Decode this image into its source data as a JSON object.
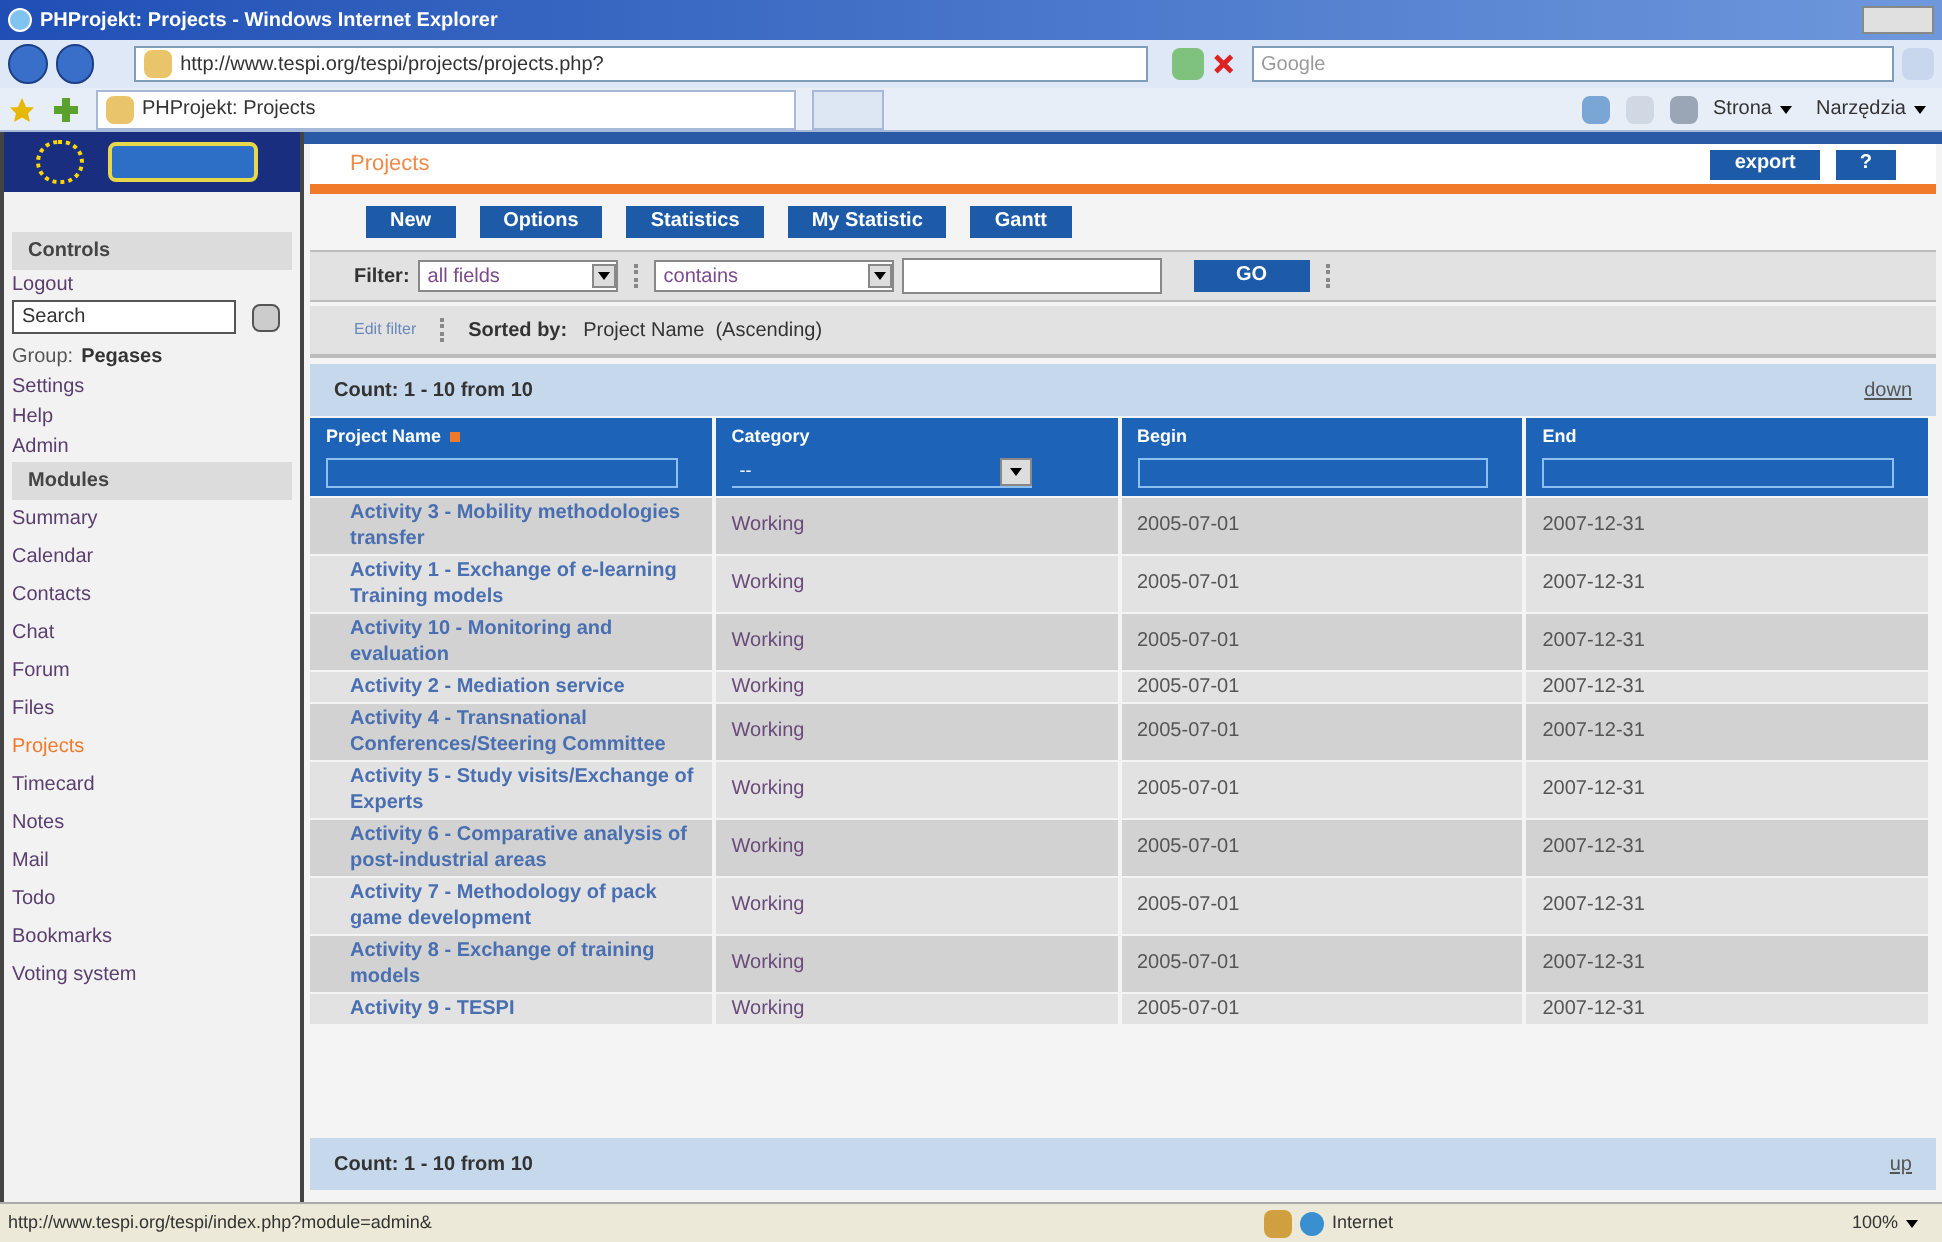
{
  "window": {
    "title": "PHProjekt: Projects - Windows Internet Explorer"
  },
  "browser": {
    "address": "http://www.tespi.org/tespi/projects/projects.php?",
    "search_placeholder": "Google",
    "tab": "PHProjekt: Projects",
    "toolbar": [
      "Strona",
      "Narzędzia"
    ]
  },
  "sidebar": {
    "controls_heading": "Controls",
    "logout": "Logout",
    "search_placeholder": "Search",
    "group_label": "Group:",
    "group_name": "Pegases",
    "links": [
      "Settings",
      "Help",
      "Admin"
    ],
    "modules_heading": "Modules",
    "modules": [
      {
        "label": "Summary",
        "selected": false
      },
      {
        "label": "Calendar",
        "selected": false
      },
      {
        "label": "Contacts",
        "selected": false
      },
      {
        "label": "Chat",
        "selected": false
      },
      {
        "label": "Forum",
        "selected": false
      },
      {
        "label": "Files",
        "selected": false
      },
      {
        "label": "Projects",
        "selected": true
      },
      {
        "label": "Timecard",
        "selected": false
      },
      {
        "label": "Notes",
        "selected": false
      },
      {
        "label": "Mail",
        "selected": false
      },
      {
        "label": "Todo",
        "selected": false
      },
      {
        "label": "Bookmarks",
        "selected": false
      },
      {
        "label": "Voting system",
        "selected": false
      }
    ]
  },
  "main": {
    "title": "Projects",
    "header_buttons": [
      "export",
      "?"
    ],
    "action_buttons": [
      "New",
      "Options",
      "Statistics",
      "My Statistic",
      "Gantt"
    ],
    "filter": {
      "label": "Filter:",
      "field": "all fields",
      "operator": "contains",
      "go": "GO"
    },
    "edit_filter": "Edit filter",
    "sorted_label": "Sorted by:",
    "sorted_value": "Project Name  (Ascending)",
    "count_top": "Count: 1 - 10 from 10",
    "down": "down",
    "columns": [
      {
        "label": "Project Name",
        "kind": "text",
        "sorted": true
      },
      {
        "label": "Category",
        "kind": "select",
        "sorted": false,
        "value": "--"
      },
      {
        "label": "Begin",
        "kind": "text",
        "sorted": false
      },
      {
        "label": "End",
        "kind": "text",
        "sorted": false
      }
    ],
    "rows": [
      {
        "name": "Activity 3 - Mobility methodologies transfer",
        "category": "Working",
        "begin": "2005-07-01",
        "end": "2007-12-31"
      },
      {
        "name": "Activity 1 - Exchange of e-learning Training models",
        "category": "Working",
        "begin": "2005-07-01",
        "end": "2007-12-31"
      },
      {
        "name": "Activity 10 - Monitoring and evaluation",
        "category": "Working",
        "begin": "2005-07-01",
        "end": "2007-12-31"
      },
      {
        "name": "Activity 2 - Mediation service",
        "category": "Working",
        "begin": "2005-07-01",
        "end": "2007-12-31"
      },
      {
        "name": "Activity 4 - Transnational Conferences/Steering Committee",
        "category": "Working",
        "begin": "2005-07-01",
        "end": "2007-12-31"
      },
      {
        "name": "Activity 5 - Study visits/Exchange of Experts",
        "category": "Working",
        "begin": "2005-07-01",
        "end": "2007-12-31"
      },
      {
        "name": "Activity 6 - Comparative analysis of post-industrial areas",
        "category": "Working",
        "begin": "2005-07-01",
        "end": "2007-12-31"
      },
      {
        "name": "Activity 7 - Methodology of pack game development",
        "category": "Working",
        "begin": "2005-07-01",
        "end": "2007-12-31"
      },
      {
        "name": "Activity 8 - Exchange of training models",
        "category": "Working",
        "begin": "2005-07-01",
        "end": "2007-12-31"
      },
      {
        "name": "Activity 9 - TESPI",
        "category": "Working",
        "begin": "2005-07-01",
        "end": "2007-12-31"
      }
    ],
    "count_bottom": "Count: 1 - 10 from 10",
    "up": "up"
  },
  "status_bar": {
    "url": "http://www.tespi.org/tespi/index.php?module=admin&",
    "zone": "Internet",
    "zoom": "100%"
  }
}
